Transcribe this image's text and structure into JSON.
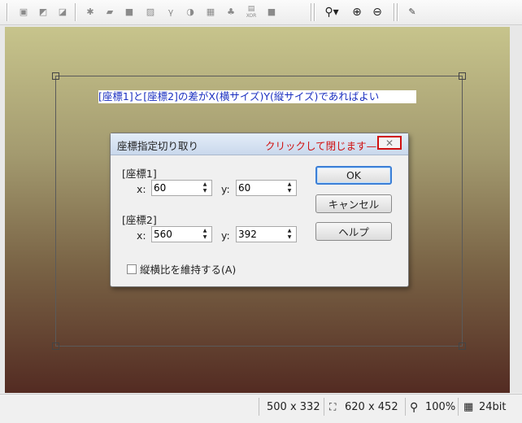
{
  "toolbar": {
    "icons": [
      "image-icon",
      "image-icon",
      "brush-icon",
      "filter-icon",
      "folder-icon",
      "square-icon",
      "texture-icon",
      "gamma-icon",
      "contrast-icon",
      "checker-icon",
      "channels-icon",
      "xor-icon",
      "fill-icon",
      "search-dropdown-icon",
      "zoom-in-icon",
      "zoom-out-icon",
      "eyedropper-icon"
    ],
    "gamma_glyph": "γ",
    "xor_label": "XOR"
  },
  "canvas": {
    "banner_text": "[座標1]と[座標2]の差がX(横サイズ)Y(縦サイズ)であればよい",
    "gradient_colors": [
      "#c7c48c",
      "#a39a6f",
      "#7a6446",
      "#532b22"
    ]
  },
  "dialog": {
    "title": "座標指定切り取り",
    "close_hint": "クリックして閉じます—→",
    "close_glyph": "✕",
    "coord1_label": "[座標1]",
    "coord2_label": "[座標2]",
    "x_label": "x:",
    "y_label": "y:",
    "coord1": {
      "x": "60",
      "y": "60"
    },
    "coord2": {
      "x": "560",
      "y": "392"
    },
    "ok_label": "OK",
    "cancel_label": "キャンセル",
    "help_label": "ヘルプ",
    "keep_ratio_label": "縦横比を維持する(A)",
    "keep_ratio_checked": false,
    "hint_color": "#d01010"
  },
  "status": {
    "selection_size": "500 x 332",
    "image_size": "620 x 452",
    "zoom": "100%",
    "bit_depth": "24bit"
  }
}
